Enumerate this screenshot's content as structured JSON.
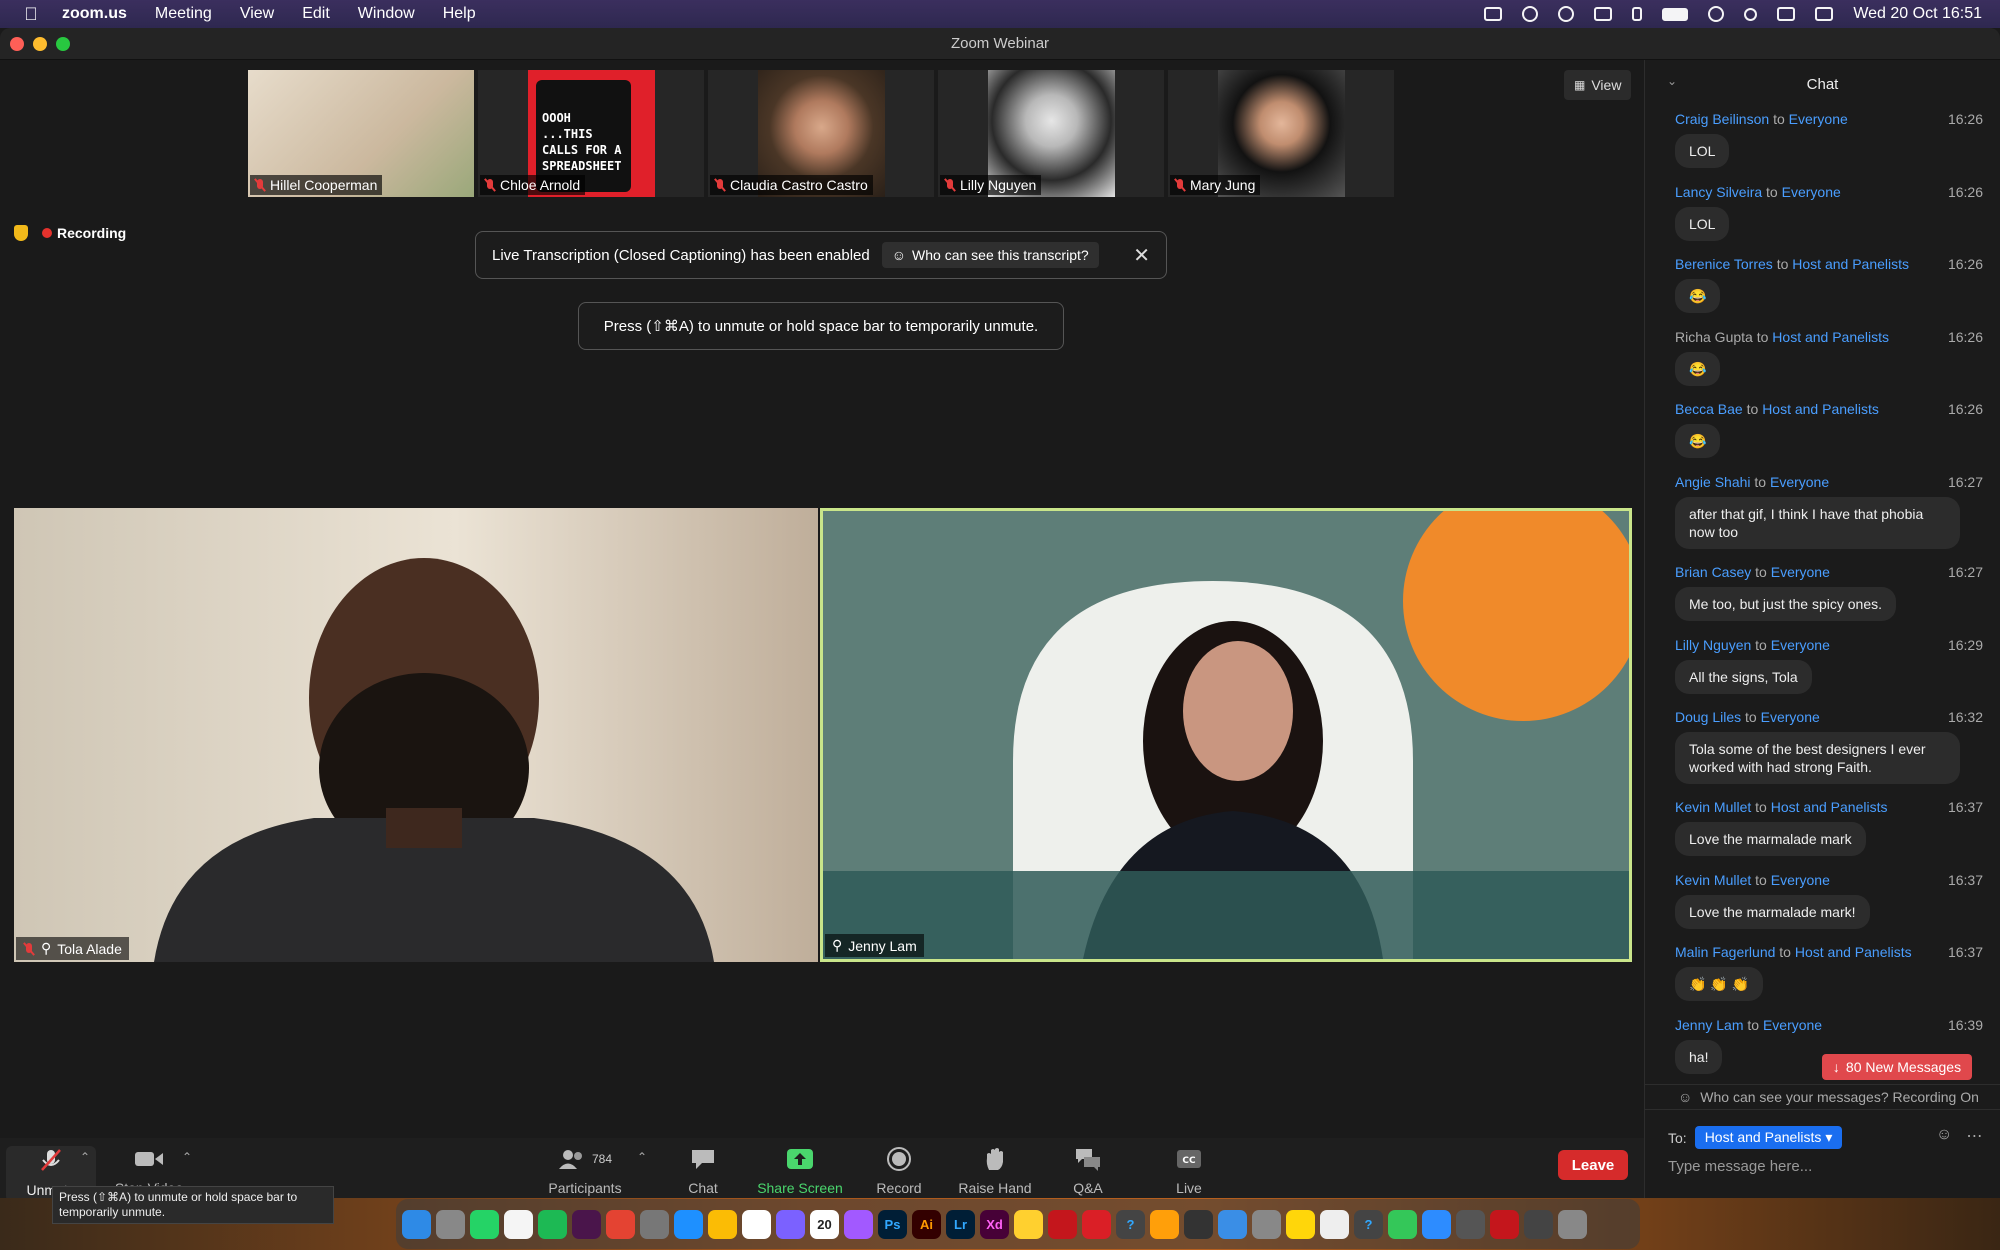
{
  "menubar": {
    "app": "zoom.us",
    "items": [
      "Meeting",
      "View",
      "Edit",
      "Window",
      "Help"
    ],
    "clock": "Wed 20 Oct  16:51"
  },
  "window": {
    "title": "Zoom Webinar"
  },
  "thumbnails": [
    {
      "name": "Hillel Cooperman",
      "bg": "#d9cfc0"
    },
    {
      "name": "Chloe Arnold",
      "bg": "#e0202a",
      "mug_text": "OOOH ...THIS CALLS FOR A SPREADSHEET"
    },
    {
      "name": "Claudia Castro Castro",
      "bg": "#6b5a4a"
    },
    {
      "name": "Lilly Nguyen",
      "bg": "#cfcfcf"
    },
    {
      "name": "Mary Jung",
      "bg": "#3a3a3a"
    }
  ],
  "view_button": "View",
  "recording": "Recording",
  "banner": {
    "text": "Live Transcription (Closed Captioning) has been enabled",
    "who": "Who can see this transcript?"
  },
  "tip": "Press  (⇧⌘A) to unmute or hold space bar to temporarily unmute.",
  "main_videos": [
    {
      "name": "Tola Alade"
    },
    {
      "name": "Jenny Lam"
    }
  ],
  "toolbar": {
    "unmute": "Unmute",
    "stop_video": "Stop Video",
    "participants": "Participants",
    "participants_count": "784",
    "chat": "Chat",
    "share_screen": "Share Screen",
    "record": "Record",
    "raise_hand": "Raise Hand",
    "qa": "Q&A",
    "live_transcript": "Live Transcript",
    "leave": "Leave",
    "unmute_tooltip": "Press  (⇧⌘A) to unmute or hold space bar to temporarily unmute."
  },
  "chat": {
    "title": "Chat",
    "messages": [
      {
        "from": "Craig Beilinson",
        "to": "Everyone",
        "time": "16:26",
        "text": "LOL"
      },
      {
        "from": "Lancy Silveira",
        "to": "Everyone",
        "time": "16:26",
        "text": "LOL"
      },
      {
        "from": "Berenice Torres",
        "to": "Host and Panelists",
        "time": "16:26",
        "text": "😂"
      },
      {
        "from": "Richa Gupta",
        "to": "Host and Panelists",
        "time": "16:26",
        "text": "😂"
      },
      {
        "from": "Becca Bae",
        "to": "Host and Panelists",
        "time": "16:26",
        "text": "😂"
      },
      {
        "from": "Angie Shahi",
        "to": "Everyone",
        "time": "16:27",
        "text": "after that gif, I think I have that phobia now too"
      },
      {
        "from": "Brian Casey",
        "to": "Everyone",
        "time": "16:27",
        "text": "Me too, but just the spicy ones."
      },
      {
        "from": "Lilly Nguyen",
        "to": "Everyone",
        "time": "16:29",
        "text": "All the signs, Tola"
      },
      {
        "from": "Doug Liles",
        "to": "Everyone",
        "time": "16:32",
        "text": "Tola some of the best designers I ever worked with had strong Faith."
      },
      {
        "from": "Kevin Mullet",
        "to": "Host and Panelists",
        "time": "16:37",
        "text": "Love the marmalade mark"
      },
      {
        "from": "Kevin Mullet",
        "to": "Everyone",
        "time": "16:37",
        "text": "Love the marmalade mark!"
      },
      {
        "from": "Malin Fagerlund",
        "to": "Host and Panelists",
        "time": "16:37",
        "text": "👏 👏 👏"
      },
      {
        "from": "Jenny Lam",
        "to": "Everyone",
        "time": "16:39",
        "text": "ha!"
      }
    ],
    "to_word": "to",
    "new_messages": "80 New Messages",
    "who_can_see": "Who can see your messages? Recording On",
    "to_label": "To:",
    "to_value": "Host and Panelists",
    "placeholder": "Type message here..."
  },
  "dock": [
    "Finder",
    "Launchpad",
    "WhatsApp",
    "Reminders",
    "Spotify",
    "Slack",
    "Todoist",
    "Calculator",
    "Safari",
    "Chrome",
    "Notion",
    "Pitch",
    "Calendar",
    "Figma",
    "Ps",
    "Ai",
    "Lr",
    "Xd",
    "Miro",
    "Acrobat",
    "CC",
    "?",
    "Photos",
    "Claquette",
    "Preview",
    "Settings",
    "Notes",
    "TextEdit",
    "?",
    "Messages",
    "Zoom",
    "Remote",
    "PDF",
    "Phone",
    "Trash"
  ],
  "dock_calendar_day": "20"
}
